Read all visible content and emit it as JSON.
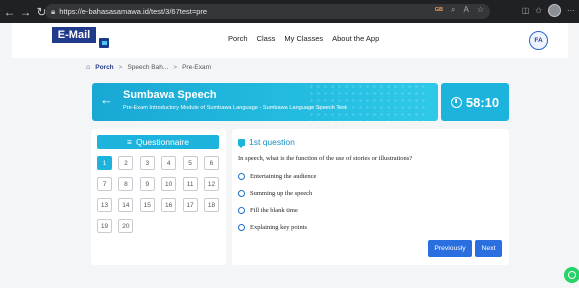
{
  "browser": {
    "url": "https://e-bahasasamawa.id/test/3/67test=pre",
    "badge": "GB"
  },
  "header": {
    "logo_text": "E-Mail",
    "menu": [
      "Porch",
      "Class",
      "My Classes",
      "About the App"
    ],
    "avatar": "FA"
  },
  "breadcrumb": [
    "Porch",
    "Speech Bah...",
    "Pre-Exam"
  ],
  "banner": {
    "title": "Sumbawa Speech",
    "subtitle": "Pre-Exam Introductory Module of Sumbawa Language - Sumbawa Language Speech Test",
    "timer": "58:10"
  },
  "questionnaire": {
    "title": "Questionnaire",
    "numbers": [
      "1",
      "2",
      "3",
      "4",
      "5",
      "6",
      "7",
      "8",
      "9",
      "10",
      "11",
      "12",
      "13",
      "14",
      "15",
      "16",
      "17",
      "18",
      "19",
      "20"
    ],
    "active": "1"
  },
  "question": {
    "title": "1st question",
    "text": "In speech, what is the function of the use of stories or illustrations?",
    "options": [
      "Entertaining the audience",
      "Summing up the speech",
      "Fill the blank time",
      "Explaining key points"
    ]
  },
  "buttons": {
    "previous": "Previously",
    "next": "Next"
  },
  "colors": {
    "accent": "#1cb3dd",
    "primary_button": "#2a6fe0",
    "logo": "#203a8c",
    "whatsapp": "#25d366"
  },
  "icons": [
    "back-icon",
    "forward-icon",
    "reload-icon",
    "lock-icon",
    "home-icon",
    "clock-icon",
    "list-icon",
    "question-icon",
    "whatsapp-icon"
  ]
}
